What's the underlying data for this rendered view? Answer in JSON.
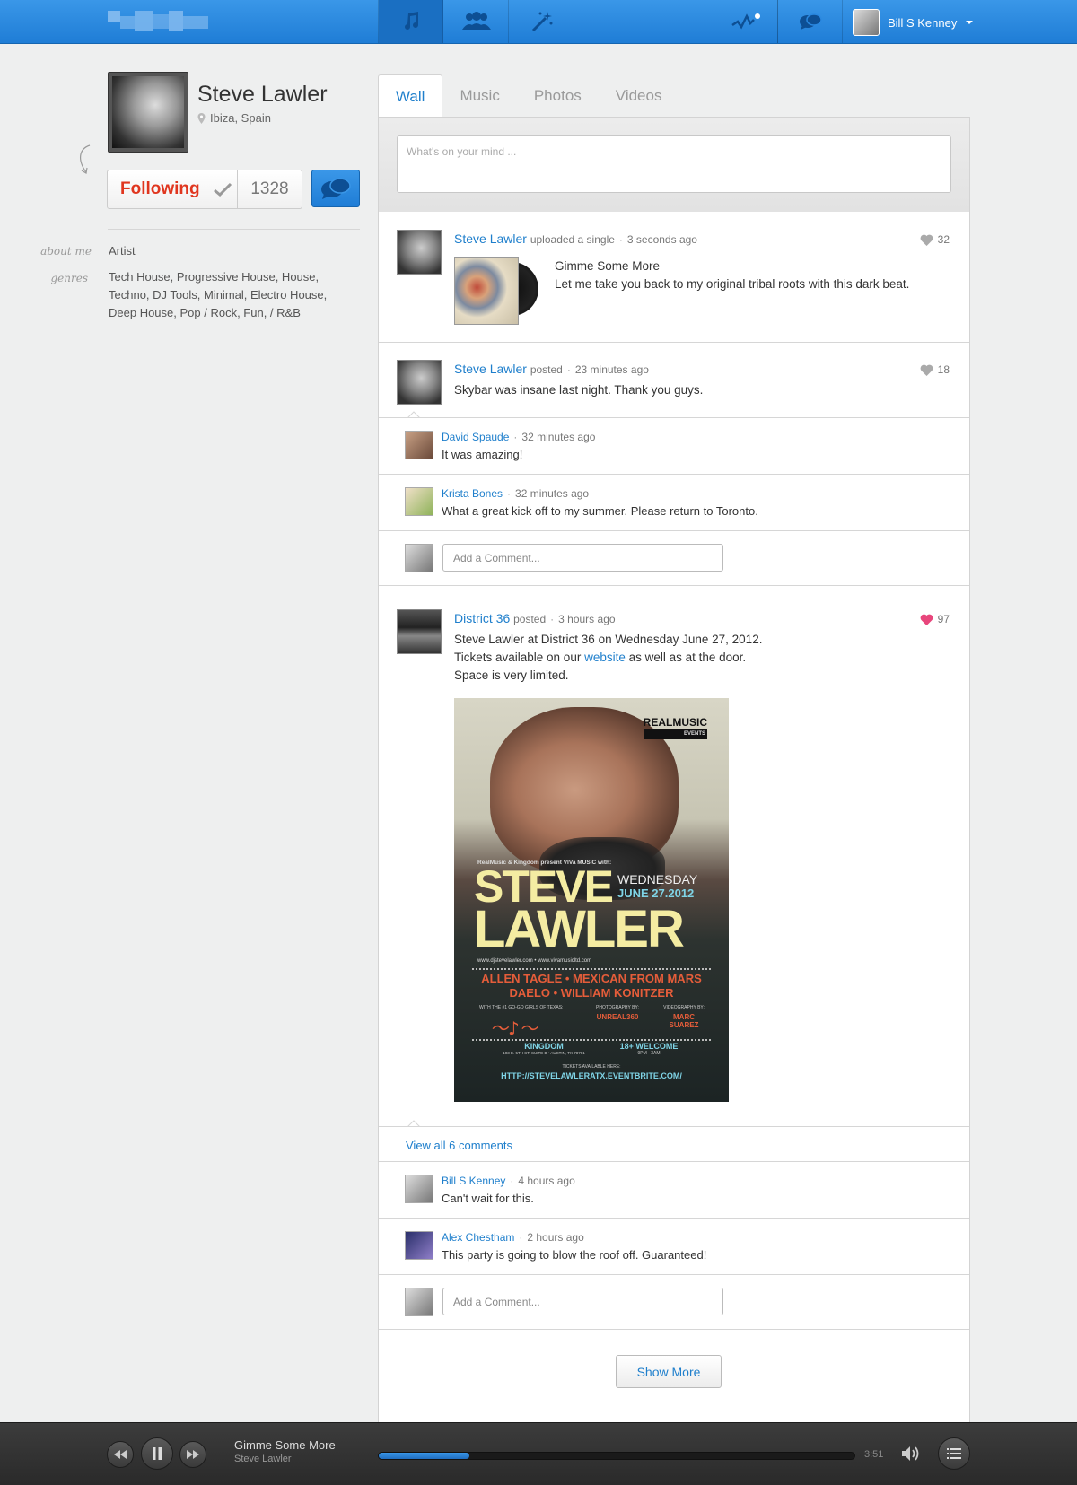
{
  "header": {
    "user_name": "Bill S Kenney"
  },
  "profile": {
    "name": "Steve Lawler",
    "location": "Ibiza, Spain",
    "follow_label": "Following",
    "followers": "1328",
    "about_label": "about me",
    "about_value": "Artist",
    "genres_label": "genres",
    "genres_value": "Tech House, Progressive House, House, Techno, DJ Tools, Minimal, Electro House, Deep House, Pop / Rock, Fun, / R&B"
  },
  "tabs": [
    "Wall",
    "Music",
    "Photos",
    "Videos"
  ],
  "composer": {
    "placeholder": "What's on your mind ..."
  },
  "posts": [
    {
      "author": "Steve Lawler",
      "action": "uploaded a single",
      "time": "3 seconds ago",
      "likes": "32",
      "track_title": "Gimme Some More",
      "track_desc": "Let me take you back to my original tribal roots with this dark beat."
    },
    {
      "author": "Steve Lawler",
      "action": "posted",
      "time": "23 minutes ago",
      "likes": "18",
      "text": "Skybar was insane last night. Thank you guys.",
      "comments": [
        {
          "name": "David Spaude",
          "time": "32 minutes ago",
          "text": "It was amazing!"
        },
        {
          "name": "Krista Bones",
          "time": "32 minutes ago",
          "text": "What a great kick off to my summer. Please return to Toronto."
        }
      ],
      "comment_placeholder": "Add a Comment..."
    },
    {
      "author": "District 36",
      "action": "posted",
      "time": "3 hours ago",
      "likes": "97",
      "text_line1": "Steve Lawler at District 36 on Wednesday June 27, 2012.",
      "text_line2_pre": "Tickets available on our ",
      "text_link": "website",
      "text_line2_post": " as well as at the door.",
      "text_line3": "Space is very limited.",
      "flyer": {
        "brand": "REALMUSIC",
        "brand_sub": "EVENTS",
        "presents": "RealMusic & Kingdom present VIVa MUSIC with:",
        "headline1": "STEVE",
        "headline2": "LAWLER",
        "day": "WEDNESDAY",
        "date": "JUNE 27.2012",
        "websites": "www.djstevelawler.com • www.vivamusicltd.com",
        "support1": "ALLEN TAGLE • MEXICAN FROM MARS",
        "support2": "DAELO • WILLIAM KONITZER",
        "gogo": "WITH THE #1 GO-GO GIRLS OF TEXAS:",
        "photo_label": "PHOTOGRAPHY BY:",
        "photo_name": "UNREAL360",
        "video_label": "VIDEOGRAPHY BY:",
        "video_name": "MARC SUAREZ",
        "venue": "KINGDOM",
        "address": "103 E. 5TH ST. SUITE B • AUSTIN, TX 78701",
        "age": "18+ WELCOME",
        "hours": "9PM - 3AM",
        "tickets_label": "TICKETS AVAILABLE HERE:",
        "tickets_url": "HTTP://STEVELAWLERATX.EVENTBRITE.COM/"
      },
      "view_all": "View all 6 comments",
      "comments": [
        {
          "name": "Bill S Kenney",
          "time": "4 hours ago",
          "text": "Can't wait for this."
        },
        {
          "name": "Alex Chestham",
          "time": "2 hours ago",
          "text": "This party is going to blow the roof off. Guaranteed!"
        }
      ],
      "comment_placeholder": "Add a Comment..."
    }
  ],
  "show_more": "Show More",
  "player": {
    "title": "Gimme Some More",
    "artist": "Steve Lawler",
    "time": "3:51",
    "progress": 0.19
  },
  "colors": {
    "accent": "#1f7fcc",
    "follow_red": "#e0361f",
    "heart_pink": "#e8467c"
  }
}
